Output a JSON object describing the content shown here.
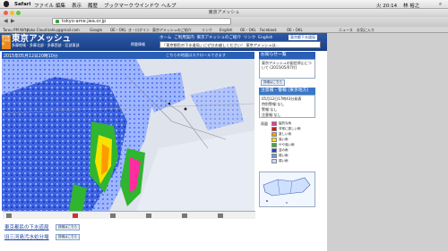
{
  "menubar": {
    "app": "Safari",
    "items": [
      "ファイル",
      "編集",
      "表示",
      "履歴",
      "ブックマーク",
      "ウインドウ",
      "ヘルプ"
    ],
    "right": [
      "火 20:14",
      "林 裕之"
    ]
  },
  "window": {
    "title": "東京アメッシュ"
  },
  "browser": {
    "url": "tokyo-ame.jwa.or.jp",
    "bookmarks": [
      "Tarou PM Nifty",
      "Koko Cloud",
      "kahiu@gmail.com",
      "Google",
      "OE・OKL",
      "き・ログイン",
      "東京アメッシュのご紹介",
      "リンク",
      "English",
      "OE・OKL",
      "Facebook",
      "OE・OKL",
      "ニュース",
      "お気に入り"
    ]
  },
  "site": {
    "org_badge": "東京都下水道局",
    "title": "東京アメッシュ",
    "subnav": [
      "多摩地域",
      "多摩北部",
      "多摩西部",
      "区部東部"
    ],
    "topnav": [
      "ホーム",
      "ご利用案内",
      "東京アメッシュのご紹介",
      "リンク",
      "English"
    ],
    "topnav_badge": "東京都下水道局",
    "alert_tag": "掲載情報",
    "alert_text": "「東京都民の下水道局」にぜひお越しください！ 東京アメッシュは..."
  },
  "map": {
    "date": "2015年05月12日20時10分",
    "note": "こちらの地図はスクロールできます"
  },
  "sidebar": {
    "notice_head": "お知らせ一覧",
    "notice_body": "東京アメッシュの配信停止について (2015/05/07付)",
    "notice_btn": "詳細はこちら",
    "info_head": "注意報・警報 (東京地方)",
    "info_lines": [
      "05月12日17時43分発表",
      "特別警報:なし",
      "警報:なし",
      "注意報:なし"
    ],
    "legend_title": "雨量",
    "legend": [
      {
        "label": "猛烈な雨",
        "color": "#ff2da0"
      },
      {
        "label": "非常に激しい雨",
        "color": "#e01010"
      },
      {
        "label": "激しい雨",
        "color": "#ff9a00"
      },
      {
        "label": "強い雨",
        "color": "#f4e400"
      },
      {
        "label": "やや強い雨",
        "color": "#2fb52f"
      },
      {
        "label": "並の雨",
        "color": "#1f3fe0"
      },
      {
        "label": "弱い雨",
        "color": "#6a98ff"
      },
      {
        "label": "弱い雨",
        "color": "#c8daff"
      }
    ]
  },
  "links": {
    "link1": "東京都民の下水道局",
    "link1_btn": "詳細はこちら",
    "link2": "旧三河島汚水処分場",
    "link2_btn": "詳細はこちら"
  }
}
